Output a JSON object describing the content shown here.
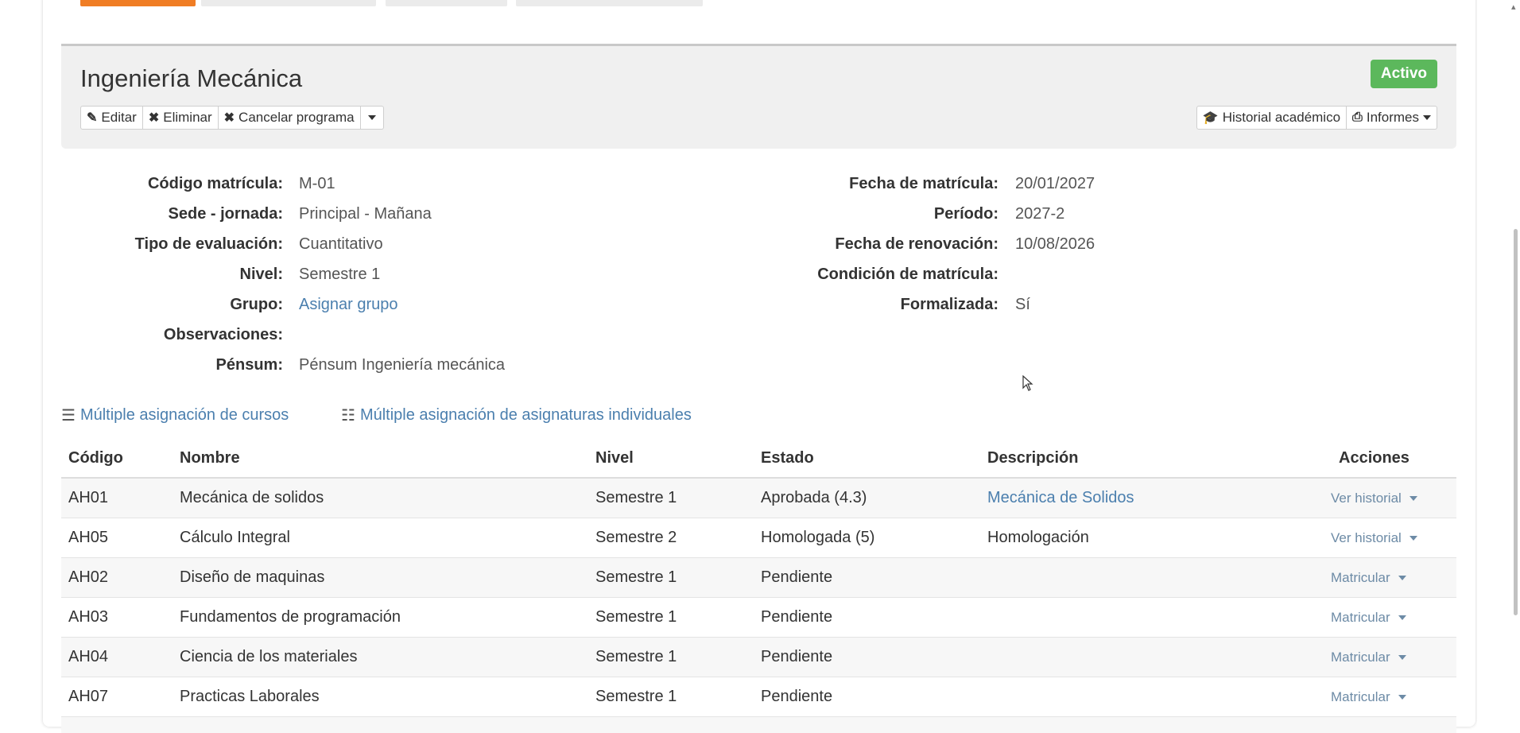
{
  "program": {
    "title": "Ingeniería Mecánica",
    "status_badge": "Activo",
    "actions": {
      "edit_label": "Editar",
      "delete_label": "Eliminar",
      "cancel_label": "Cancelar programa",
      "history_label": "Historial académico",
      "reports_label": "Informes"
    }
  },
  "details": {
    "left": [
      {
        "label": "Código matrícula:",
        "value": "M-01"
      },
      {
        "label": "Sede - jornada:",
        "value": "Principal - Mañana"
      },
      {
        "label": "Tipo de evaluación:",
        "value": "Cuantitativo"
      },
      {
        "label": "Nivel:",
        "value": "Semestre 1"
      },
      {
        "label": "Grupo:",
        "value": "Asignar grupo"
      },
      {
        "label": "Observaciones:",
        "value": ""
      },
      {
        "label": "Pénsum:",
        "value": "Pénsum Ingeniería mecánica"
      }
    ],
    "right": [
      {
        "label": "Fecha de matrícula:",
        "value": "20/01/2027"
      },
      {
        "label": "Período:",
        "value": "2027-2"
      },
      {
        "label": "Fecha de renovación:",
        "value": "10/08/2026"
      },
      {
        "label": "Condición de matrícula:",
        "value": ""
      },
      {
        "label": "Formalizada:",
        "value": "Sí"
      }
    ]
  },
  "mass_assign": {
    "courses_label": "Múltiple asignación de cursos",
    "subjects_label": "Múltiple asignación de asignaturas individuales"
  },
  "table": {
    "headers": {
      "code": "Código",
      "name": "Nombre",
      "level": "Nivel",
      "status": "Estado",
      "description": "Descripción",
      "actions": "Acciones"
    },
    "rows": [
      {
        "code": "AH01",
        "name": "Mecánica de solidos",
        "level": "Semestre 1",
        "status": "Aprobada (4.3)",
        "description": "Mecánica de Solidos",
        "action": "Ver historial"
      },
      {
        "code": "AH05",
        "name": "Cálculo Integral",
        "level": "Semestre 2",
        "status": "Homologada (5)",
        "description": "Homologación",
        "action": "Ver historial"
      },
      {
        "code": "AH02",
        "name": "Diseño de maquinas",
        "level": "Semestre 1",
        "status": "Pendiente",
        "description": "",
        "action": "Matricular"
      },
      {
        "code": "AH03",
        "name": "Fundamentos de programación",
        "level": "Semestre 1",
        "status": "Pendiente",
        "description": "",
        "action": "Matricular"
      },
      {
        "code": "AH04",
        "name": "Ciencia de los materiales",
        "level": "Semestre 1",
        "status": "Pendiente",
        "description": "",
        "action": "Matricular"
      },
      {
        "code": "AH07",
        "name": "Practicas Laborales",
        "level": "Semestre 1",
        "status": "Pendiente",
        "description": "",
        "action": "Matricular"
      }
    ]
  },
  "colors": {
    "accent_tab": "#f07d24",
    "status_active": "#5cb85c",
    "link": "#4b7fae"
  }
}
